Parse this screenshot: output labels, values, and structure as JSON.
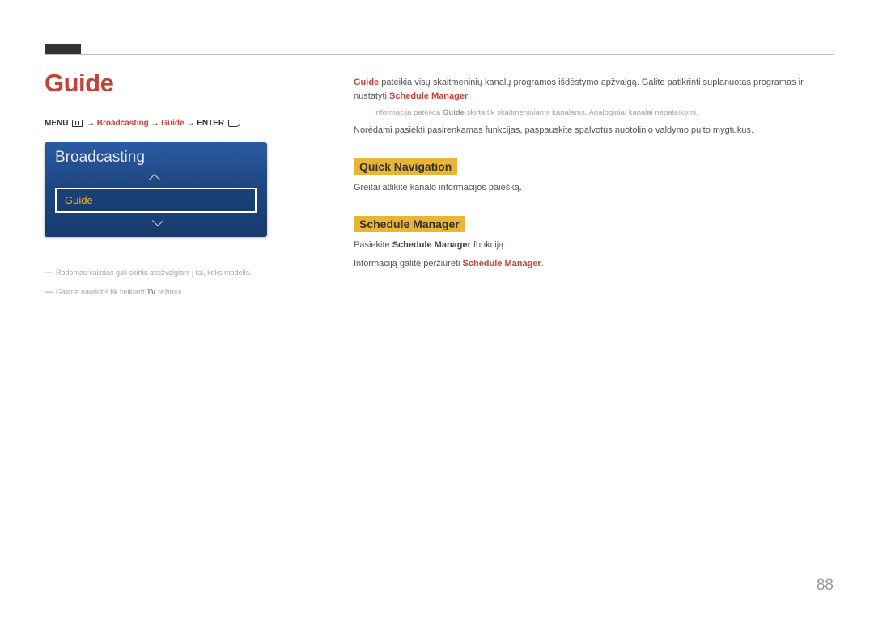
{
  "page": {
    "title": "Guide",
    "number": "88"
  },
  "breadcrumb": {
    "menu": "MENU",
    "seg1": "Broadcasting",
    "seg2": "Guide",
    "enter": "ENTER",
    "arrow": "→"
  },
  "panel": {
    "title": "Broadcasting",
    "selected": "Guide"
  },
  "footnotes": {
    "n1": "Rodomas vaizdas gali skirtis atsižvelgiant į tai, koks modelis.",
    "n2_a": "Galima naudotis tik veikiant ",
    "n2_bold": "TV",
    "n2_b": " režimui."
  },
  "intro": {
    "p1_a": "Guide",
    "p1_b": " pateikia visų skaitmeninių kanalų programos išdėstymo apžvalgą. Galite patikrinti suplanuotas programas ir nustatyti ",
    "p1_c": "Schedule Manager",
    "p1_d": ".",
    "note_a": "Informacija pateikta ",
    "note_kw": "Guide",
    "note_b": " skirta tik skaitmeniniams kanalams. Analoginiai kanalai nepalaikomi.",
    "p2": "Norėdami pasiekti pasirenkamas funkcijas, paspauskite spalvotus nuotolinio valdymo pulto mygtukus."
  },
  "sections": {
    "quick_nav": {
      "title": "Quick Navigation",
      "p1": "Greitai atlikite kanalo informacijos paiešką."
    },
    "sched_mgr": {
      "title": "Schedule Manager",
      "p1_a": "Pasiekite ",
      "p1_bold": "Schedule Manager",
      "p1_b": " funkciją.",
      "p2_a": "Informaciją galite peržiūrėti ",
      "p2_kw": "Schedule Manager",
      "p2_b": "."
    }
  }
}
